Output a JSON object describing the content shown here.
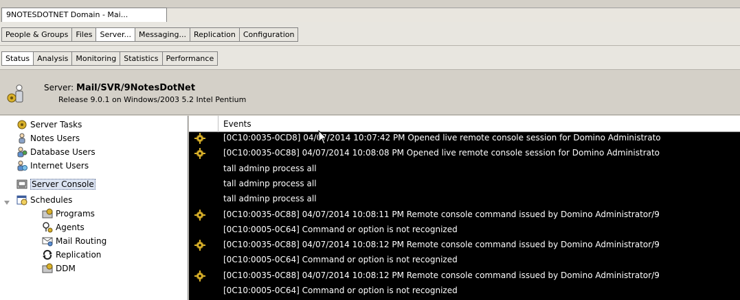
{
  "window_tab": {
    "title": "9NOTESDOTNET Domain - Mai..."
  },
  "main_tabs": [
    {
      "label": "People & Groups",
      "active": false
    },
    {
      "label": "Files",
      "active": false
    },
    {
      "label": "Server...",
      "active": true
    },
    {
      "label": "Messaging...",
      "active": false
    },
    {
      "label": "Replication",
      "active": false
    },
    {
      "label": "Configuration",
      "active": false
    }
  ],
  "sub_tabs": [
    {
      "label": "Status",
      "active": true
    },
    {
      "label": "Analysis",
      "active": false
    },
    {
      "label": "Monitoring",
      "active": false
    },
    {
      "label": "Statistics",
      "active": false
    },
    {
      "label": "Performance",
      "active": false
    }
  ],
  "header": {
    "server_prefix": "Server:",
    "server_name": "Mail/SVR/9NotesDotNet",
    "release": "Release 9.0.1 on Windows/2003 5.2 Intel Pentium"
  },
  "tree": {
    "items": [
      {
        "label": "Server Tasks",
        "icon": "gear-icon"
      },
      {
        "label": "Notes Users",
        "icon": "user-icon"
      },
      {
        "label": "Database Users",
        "icon": "users-icon"
      },
      {
        "label": "Internet Users",
        "icon": "globe-user-icon"
      },
      {
        "label": "Server Console",
        "icon": "console-icon",
        "selected": true
      },
      {
        "label": "Schedules",
        "icon": "schedule-icon",
        "expanded": true
      },
      {
        "label": "Programs",
        "icon": "program-icon"
      },
      {
        "label": "Agents",
        "icon": "agent-icon"
      },
      {
        "label": "Mail Routing",
        "icon": "mail-routing-icon"
      },
      {
        "label": "Replication",
        "icon": "replication-icon"
      },
      {
        "label": "DDM",
        "icon": "ddm-icon"
      }
    ]
  },
  "events": {
    "column_header": "Events",
    "rows": [
      {
        "text": "[0C10:0035-0CD8] 04/07/2014 10:07:42 PM  Opened live remote console session for Domino Administrato",
        "icon": true
      },
      {
        "text": "[0C10:0035-0C88] 04/07/2014 10:08:08 PM  Opened live remote console session for Domino Administrato",
        "icon": true
      },
      {
        "text": "tall adminp process all",
        "icon": false
      },
      {
        "text": "tall adminp process all",
        "icon": false
      },
      {
        "text": "tall adminp process all",
        "icon": false
      },
      {
        "text": "[0C10:0035-0C88] 04/07/2014 10:08:11 PM  Remote console command issued by Domino Administrator/9",
        "icon": true
      },
      {
        "text": "[0C10:0005-0C64] Command or option is not recognized",
        "icon": false
      },
      {
        "text": "[0C10:0035-0C88] 04/07/2014 10:08:12 PM  Remote console command issued by Domino Administrator/9",
        "icon": true
      },
      {
        "text": "[0C10:0005-0C64] Command or option is not recognized",
        "icon": false
      },
      {
        "text": "[0C10:0035-0C88] 04/07/2014 10:08:12 PM  Remote console command issued by Domino Administrator/9",
        "icon": true
      },
      {
        "text": "[0C10:0005-0C64] Command or option is not recognized",
        "icon": false
      }
    ]
  },
  "colors": {
    "event_bg": "#000000",
    "event_text": "#ffffff",
    "event_icon": "#d9b12a",
    "selection": "#dce4f2"
  }
}
